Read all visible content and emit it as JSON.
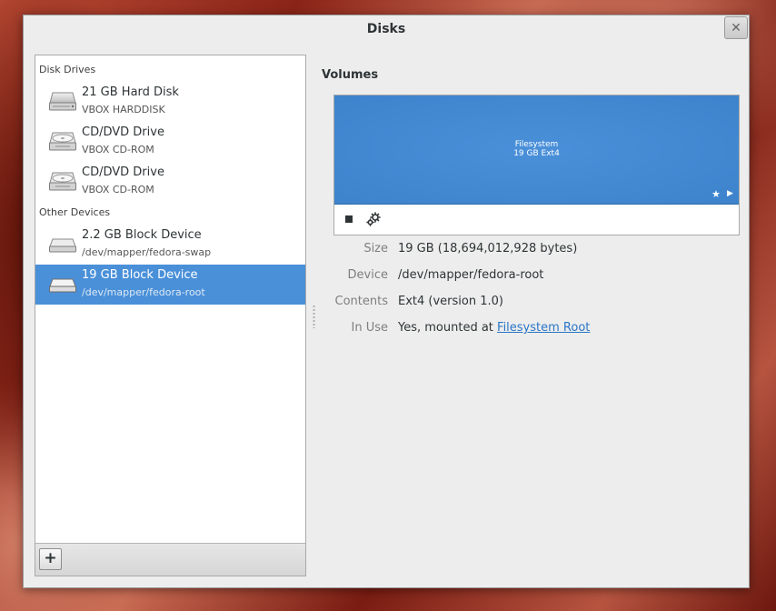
{
  "window": {
    "title": "Disks",
    "close_glyph": "✕"
  },
  "sidebar": {
    "sections": [
      {
        "header": "Disk Drives"
      },
      {
        "header": "Other Devices"
      }
    ],
    "items": [
      {
        "name": "21 GB Hard Disk",
        "sub": "VBOX HARDDISK",
        "icon": "hard-disk-icon"
      },
      {
        "name": "CD/DVD Drive",
        "sub": "VBOX CD-ROM",
        "icon": "optical-drive-icon"
      },
      {
        "name": "CD/DVD Drive",
        "sub": "VBOX CD-ROM",
        "icon": "optical-drive-icon"
      },
      {
        "name": "2.2 GB Block Device",
        "sub": "/dev/mapper/fedora-swap",
        "icon": "block-device-icon"
      },
      {
        "name": "19 GB Block Device",
        "sub": "/dev/mapper/fedora-root",
        "icon": "block-device-icon",
        "selected": true
      }
    ],
    "add_label": "+"
  },
  "volumes": {
    "heading": "Volumes",
    "segment": {
      "line1": "Filesystem",
      "line2": "19 GB Ext4",
      "color": "#4a90d9"
    },
    "star_glyph": "★",
    "play_glyph": "▶",
    "details": [
      {
        "label": "Size",
        "value": "19 GB (18,694,012,928 bytes)"
      },
      {
        "label": "Device",
        "value": "/dev/mapper/fedora-root"
      },
      {
        "label": "Contents",
        "value": "Ext4 (version 1.0)"
      },
      {
        "label": "In Use",
        "value_prefix": "Yes, mounted at ",
        "link_text": "Filesystem Root"
      }
    ]
  },
  "colors": {
    "selection": "#4a90d9",
    "link": "#2a76c6"
  }
}
